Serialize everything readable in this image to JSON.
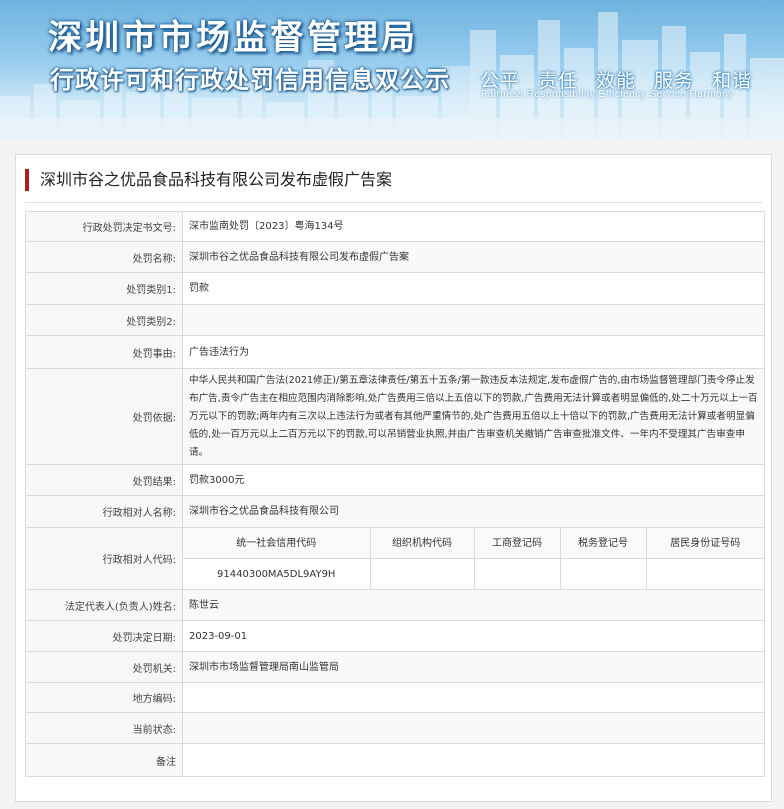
{
  "banner": {
    "title": "深圳市市场监督管理局",
    "subtitle": "行政许可和行政处罚信用信息双公示",
    "slogan": [
      "公平",
      "责任",
      "效能",
      "服务",
      "和谐"
    ],
    "slogan_en": "Fairness  Responsibility  Efficiency  Service  Harmony"
  },
  "case": {
    "title": "深圳市谷之优品食品科技有限公司发布虚假广告案"
  },
  "rows": [
    {
      "label": "行政处罚决定书文号:",
      "value": "深市监南处罚〔2023〕粤海134号"
    },
    {
      "label": "处罚名称:",
      "value": "深圳市谷之优品食品科技有限公司发布虚假广告案"
    },
    {
      "label": "处罚类别1:",
      "value": "罚款"
    },
    {
      "label": "处罚类别2:",
      "value": ""
    },
    {
      "label": "处罚事由:",
      "value": "广告违法行为"
    },
    {
      "label": "处罚依据:",
      "value": "中华人民共和国广告法(2021修正)/第五章法律责任/第五十五条/第一款违反本法规定,发布虚假广告的,由市场监督管理部门责令停止发布广告,责令广告主在相应范围内消除影响,处广告费用三倍以上五倍以下的罚款,广告费用无法计算或者明显偏低的,处二十万元以上一百万元以下的罚款;两年内有三次以上违法行为或者有其他严重情节的,处广告费用五倍以上十倍以下的罚款,广告费用无法计算或者明显偏低的,处一百万元以上二百万元以下的罚款,可以吊销营业执照,并由广告审查机关撤销广告审查批准文件、一年内不受理其广告审查申请。"
    },
    {
      "label": "处罚结果:",
      "value": "罚款3000元"
    },
    {
      "label": "行政相对人名称:",
      "value": "深圳市谷之优品食品科技有限公司"
    }
  ],
  "codes": {
    "label": "行政相对人代码:",
    "headers": [
      "统一社会信用代码",
      "组织机构代码",
      "工商登记码",
      "税务登记号",
      "居民身份证号码"
    ],
    "values": [
      "91440300MA5DL9AY9H",
      "",
      "",
      "",
      ""
    ]
  },
  "rows2": [
    {
      "label": "法定代表人(负责人)姓名:",
      "value": "陈世云"
    },
    {
      "label": "处罚决定日期:",
      "value": "2023-09-01"
    },
    {
      "label": "处罚机关:",
      "value": "深圳市市场监督管理局南山监管局"
    },
    {
      "label": "地方编码:",
      "value": ""
    },
    {
      "label": "当前状态:",
      "value": ""
    },
    {
      "label": "备注",
      "value": ""
    }
  ]
}
